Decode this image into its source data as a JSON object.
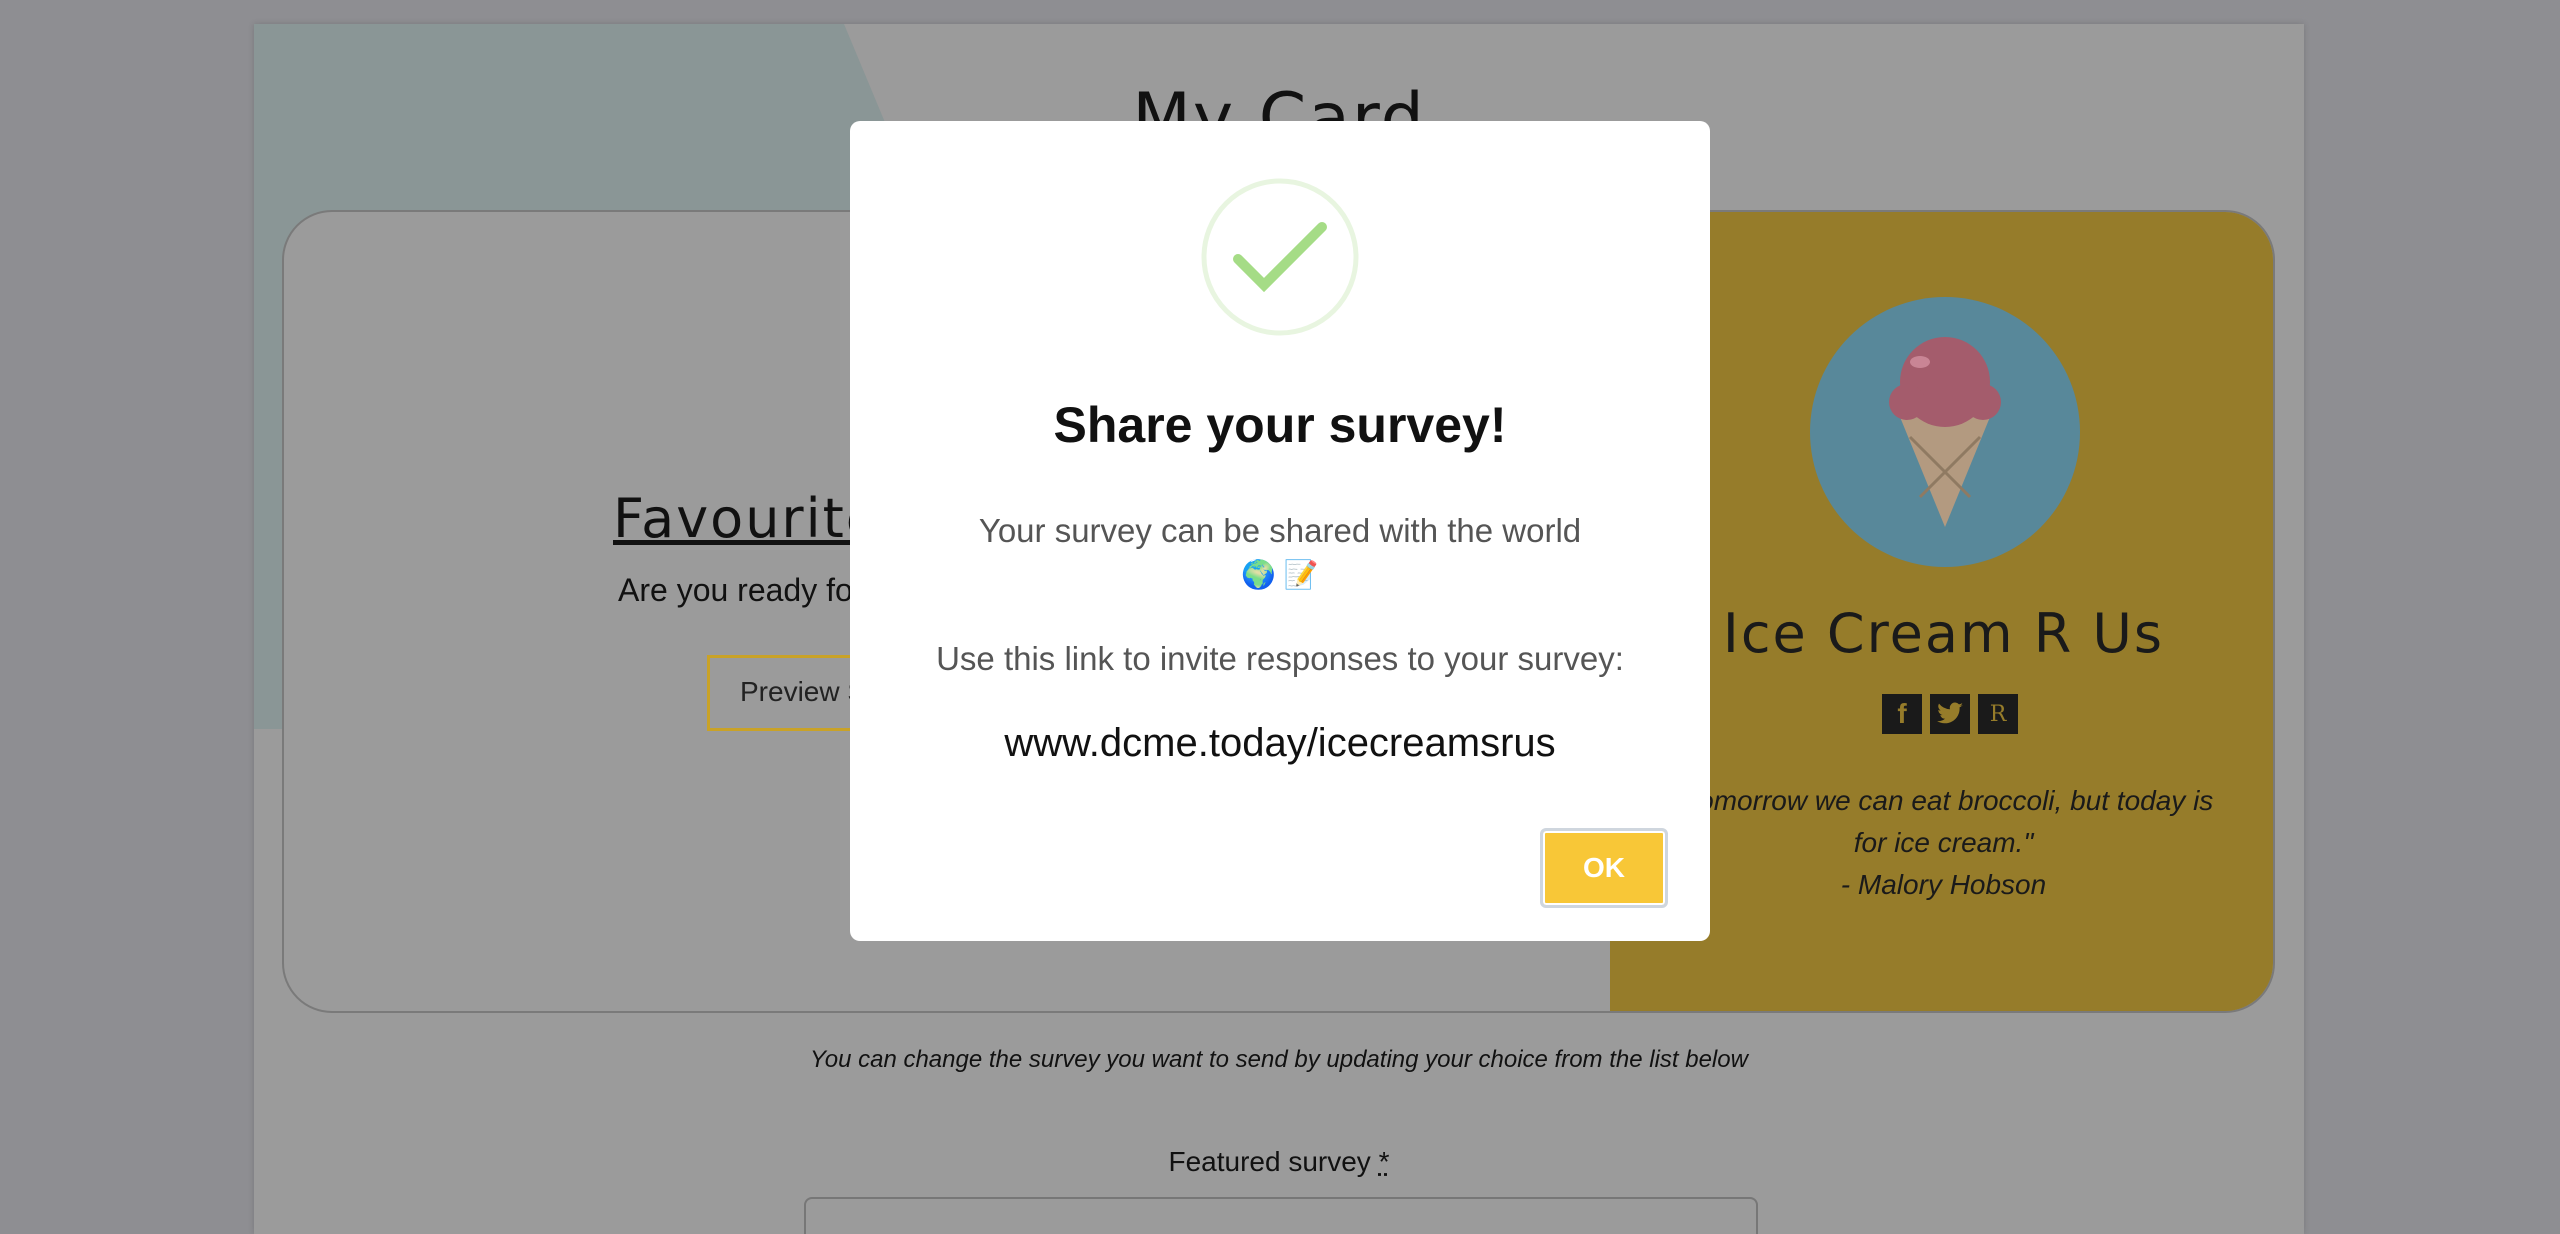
{
  "page": {
    "title": "My Card"
  },
  "card": {
    "heading": "Favourite",
    "subtext": "Are you ready fo",
    "preview_label": "Preview S",
    "brand_name": "Ice Cream R Us",
    "socials": [
      "facebook-icon",
      "twitter-icon",
      "r-icon"
    ],
    "social_r_label": "R",
    "quote": "\"Tomorrow we can eat broccoli, but today is for ice cream.\"",
    "quote_author": "- Malory Hobson"
  },
  "form": {
    "change_note": "You can change the survey you want to send by updating your choice from the list below",
    "featured_label": "Featured survey",
    "required_marker": "*"
  },
  "modal": {
    "title": "Share your survey!",
    "text": "Your survey can be shared with the world",
    "emojis": "🌍 📝",
    "link_intro": "Use this link to invite responses to your survey:",
    "url": "www.dcme.today/icecreamsrus",
    "ok_label": "OK"
  },
  "colors": {
    "accent": "#f8c737",
    "overlay": "#8e8e92",
    "brand_panel": "#967c2a",
    "check_green": "#a5dc86"
  }
}
